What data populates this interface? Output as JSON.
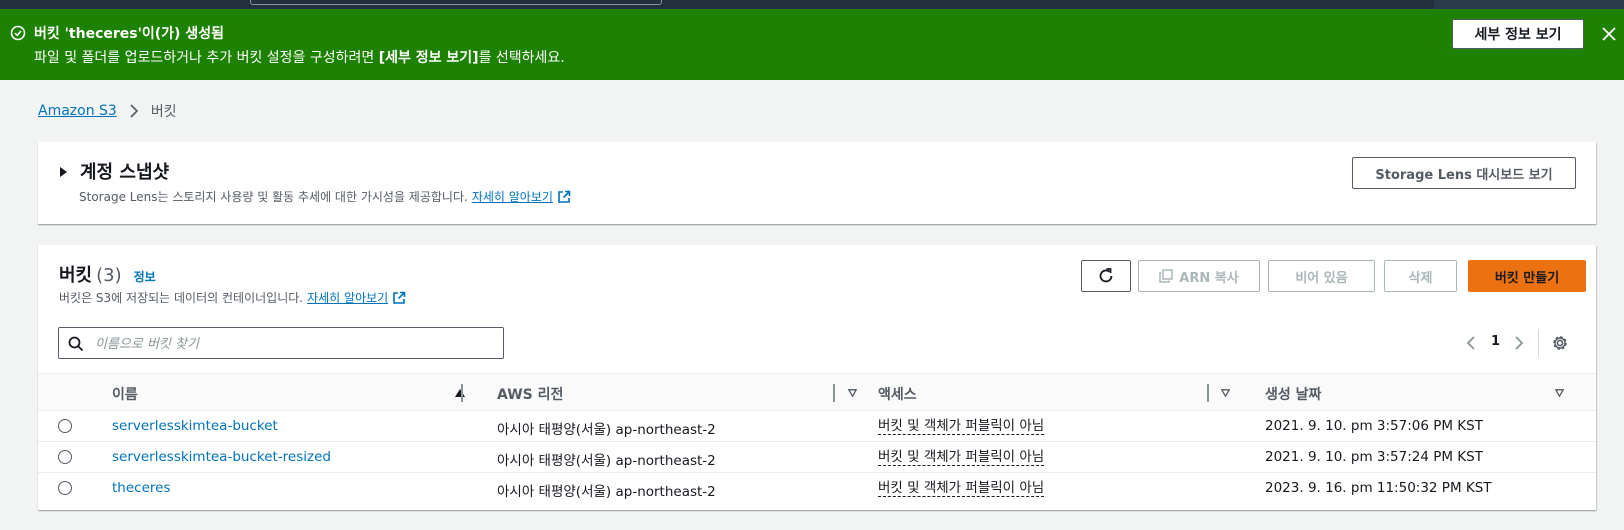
{
  "banner": {
    "title": "버킷 'theceres'이(가) 생성됨",
    "message_before": "파일 및 폴더를 업로드하거나 추가 버킷 설정을 구성하려면 ",
    "message_bold": "[세부 정보 보기]",
    "message_after": "를 선택하세요.",
    "view_details_button": "세부 정보 보기",
    "color": "#1d8102"
  },
  "breadcrumb": {
    "root": "Amazon S3",
    "current": "버킷"
  },
  "account_snapshot": {
    "title": "계정 스냅샷",
    "description": "Storage Lens는 스토리지 사용량 및 활동 추세에 대한 가시성을 제공합니다.",
    "learn_more": "자세히 알아보기",
    "dashboard_button": "Storage Lens 대시보드 보기"
  },
  "buckets": {
    "title": "버킷",
    "count": "(3)",
    "info_link": "정보",
    "description": "버킷은 S3에 저장되는 데이터의 컨테이너입니다.",
    "learn_more": "자세히 알아보기",
    "buttons": {
      "copy_arn": "ARN 복사",
      "empty": "비어 있음",
      "delete": "삭제",
      "create": "버킷 만들기"
    },
    "search_placeholder": "이름으로 버킷 찾기",
    "page_number": "1",
    "columns": {
      "name": "이름",
      "region": "AWS 리전",
      "access": "액세스",
      "created": "생성 날짜"
    },
    "rows": [
      {
        "name": "serverlesskimtea-bucket",
        "region": "아시아 태평양(서울) ap-northeast-2",
        "access": "버킷 및 객체가 퍼블릭이 아님",
        "created": "2021. 9. 10. pm 3:57:06 PM KST"
      },
      {
        "name": "serverlesskimtea-bucket-resized",
        "region": "아시아 태평양(서울) ap-northeast-2",
        "access": "버킷 및 객체가 퍼블릭이 아님",
        "created": "2021. 9. 10. pm 3:57:24 PM KST"
      },
      {
        "name": "theceres",
        "region": "아시아 태평양(서울) ap-northeast-2",
        "access": "버킷 및 객체가 퍼블릭이 아님",
        "created": "2023. 9. 16. pm 11:50:32 PM KST"
      }
    ]
  },
  "colors": {
    "accent_orange": "#ec7211",
    "link_blue": "#0073bb",
    "header_dark": "#232f3e"
  }
}
